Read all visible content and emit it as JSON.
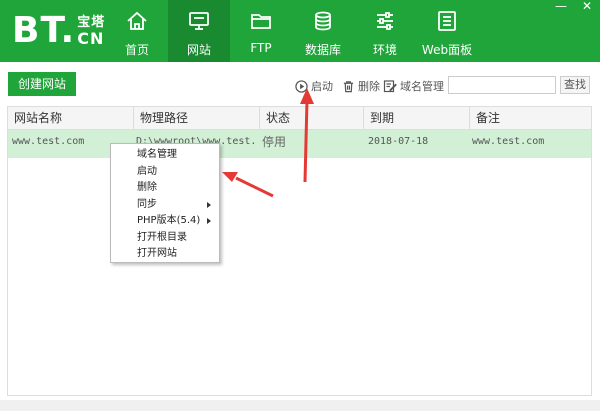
{
  "logo": {
    "bt": "BT.",
    "cn": "宝塔",
    "dot": "CN"
  },
  "nav": [
    {
      "label": "首页",
      "icon": "home-icon"
    },
    {
      "label": "网站",
      "icon": "monitor-icon",
      "active": true
    },
    {
      "label": "FTP",
      "icon": "folder-icon"
    },
    {
      "label": "数据库",
      "icon": "database-icon"
    },
    {
      "label": "环境",
      "icon": "sliders-icon"
    },
    {
      "label": "Web面板",
      "icon": "panel-list-icon"
    }
  ],
  "window": {
    "minimize": "—",
    "close": "✕"
  },
  "toolbar": {
    "create_label": "创建网站",
    "start_label": "启动",
    "delete_label": "删除",
    "domain_label": "域名管理",
    "search_placeholder": "",
    "search_label": "查找"
  },
  "table": {
    "headers": [
      "网站名称",
      "物理路径",
      "状态",
      "到期",
      "备注"
    ],
    "rows": [
      {
        "name": "www.test.com",
        "path": "D:\\wwwroot\\www.test...",
        "status": "停用",
        "expire": "2018-07-18",
        "note": "www.test.com"
      }
    ]
  },
  "context_menu": [
    {
      "label": "域名管理"
    },
    {
      "label": "启动"
    },
    {
      "label": "删除"
    },
    {
      "label": "同步",
      "submenu": true
    },
    {
      "label": "PHP版本(5.4)",
      "submenu": true
    },
    {
      "label": "打开根目录"
    },
    {
      "label": "打开网站"
    }
  ],
  "colors": {
    "brand": "#20a53a",
    "brand_dark": "#1a8a30",
    "row_selected": "#d2f0d6",
    "annotation_arrow": "#e53935"
  }
}
